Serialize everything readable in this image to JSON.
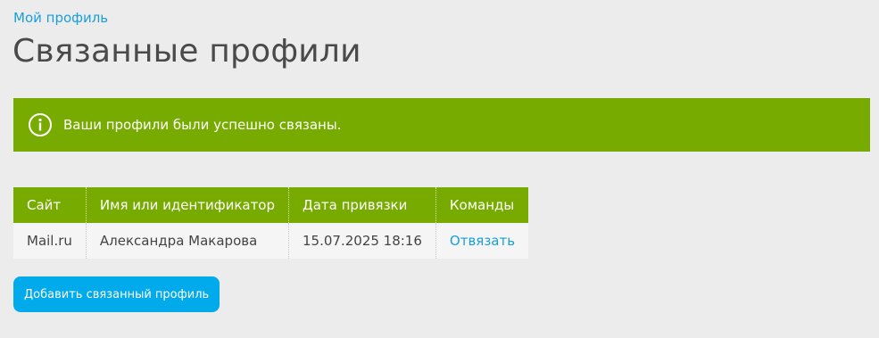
{
  "breadcrumb": {
    "label": "Мой профиль"
  },
  "page": {
    "title": "Связанные профили"
  },
  "message": {
    "icon": "info-icon",
    "text": "Ваши профили были успешно связаны.",
    "color": "#77ab00"
  },
  "table": {
    "headers": {
      "site": "Сайт",
      "name": "Имя или идентификатор",
      "date": "Дата привязки",
      "commands": "Команды"
    },
    "rows": [
      {
        "site": "Mail.ru",
        "name": "Александра Макарова",
        "date": "15.07.2025 18:16",
        "command": "Отвязать"
      }
    ]
  },
  "actions": {
    "add_label": "Добавить связанный профиль",
    "accent_color": "#00aaeb"
  }
}
